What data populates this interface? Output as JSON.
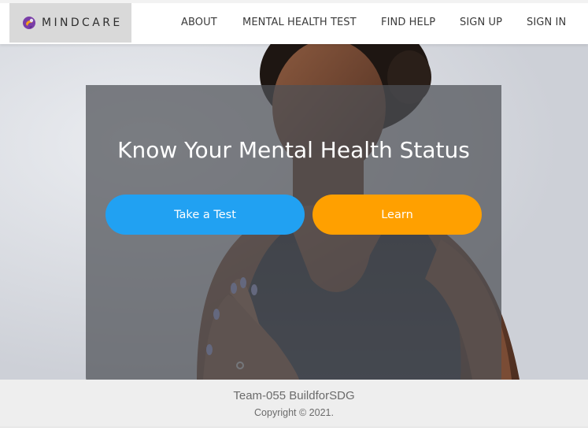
{
  "brand": {
    "name": "MINDCARE",
    "icon": "mindcare-logo-icon"
  },
  "nav": {
    "items": [
      {
        "label": "ABOUT"
      },
      {
        "label": "MENTAL HEALTH TEST"
      },
      {
        "label": "FIND HELP"
      },
      {
        "label": "SIGN UP"
      },
      {
        "label": "SIGN IN"
      }
    ]
  },
  "hero": {
    "title": "Know Your Mental Health Status",
    "primary_button": "Take a Test",
    "secondary_button": "Learn"
  },
  "footer": {
    "team": "Team-055 BuildforSDG",
    "copyright": "Copyright © 2021."
  },
  "colors": {
    "primary_button": "#21a1f2",
    "secondary_button": "#ffa000",
    "overlay": "#4e5056"
  }
}
